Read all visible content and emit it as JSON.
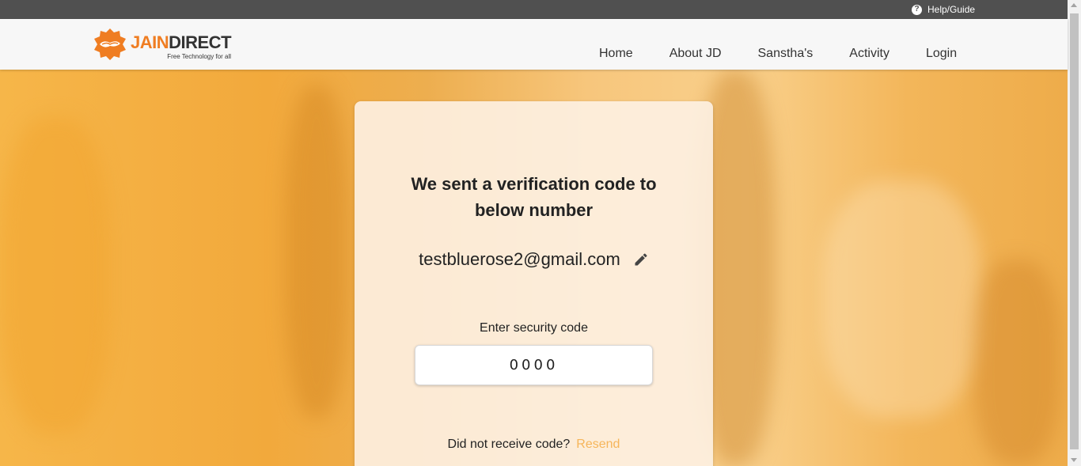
{
  "topbar": {
    "help_label": "Help/Guide",
    "help_icon": "question-circle-icon"
  },
  "logo": {
    "name_part1": "JAIN",
    "name_part2": "DIRECT",
    "tagline": "Free Technology for all",
    "icon": "hands-logo-icon"
  },
  "nav": {
    "items": [
      "Home",
      "About JD",
      "Sanstha's",
      "Activity",
      "Login"
    ]
  },
  "card": {
    "title": "We sent a verification code to below number",
    "email": "testbluerose2@gmail.com",
    "edit_icon": "pencil-edit-icon",
    "code_label": "Enter security code",
    "code_value": "0000",
    "resend_prompt": "Did not receive code?",
    "resend_label": "Resend"
  },
  "colors": {
    "brand_orange": "#ef7d22",
    "resend": "#f6b55a",
    "topbar": "#505050"
  }
}
